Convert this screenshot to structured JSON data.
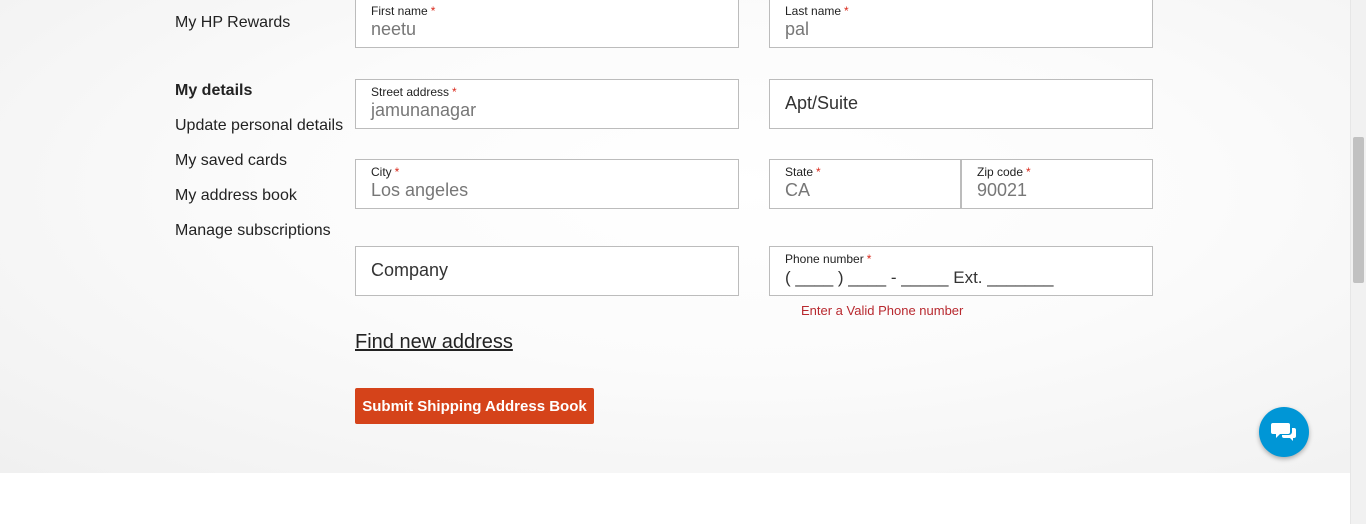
{
  "sidebar": {
    "rewards": "My HP Rewards",
    "details_heading": "My details",
    "items": [
      "Update personal details",
      "My saved cards",
      "My address book",
      "Manage subscriptions"
    ]
  },
  "form": {
    "required_mark": "*",
    "first_name": {
      "label": "First name",
      "value": "neetu"
    },
    "last_name": {
      "label": "Last name",
      "value": "pal"
    },
    "street": {
      "label": "Street address",
      "value": "jamunanagar"
    },
    "apt": {
      "placeholder": "Apt/Suite"
    },
    "city": {
      "label": "City",
      "value": "Los angeles"
    },
    "state": {
      "label": "State",
      "value": "CA"
    },
    "zip": {
      "label": "Zip code",
      "value": "90021"
    },
    "company": {
      "placeholder": "Company"
    },
    "phone": {
      "label": "Phone number",
      "mask": "( ____ ) ____ - _____ Ext. _______"
    },
    "phone_error": "Enter a Valid Phone number",
    "find_address": "Find new address",
    "submit_label": "Submit Shipping Address Book"
  },
  "colors": {
    "accent": "#d5431a",
    "error": "#b8292f",
    "chat": "#0096d6"
  },
  "icons": {
    "chat": "chat-bubbles-icon"
  }
}
